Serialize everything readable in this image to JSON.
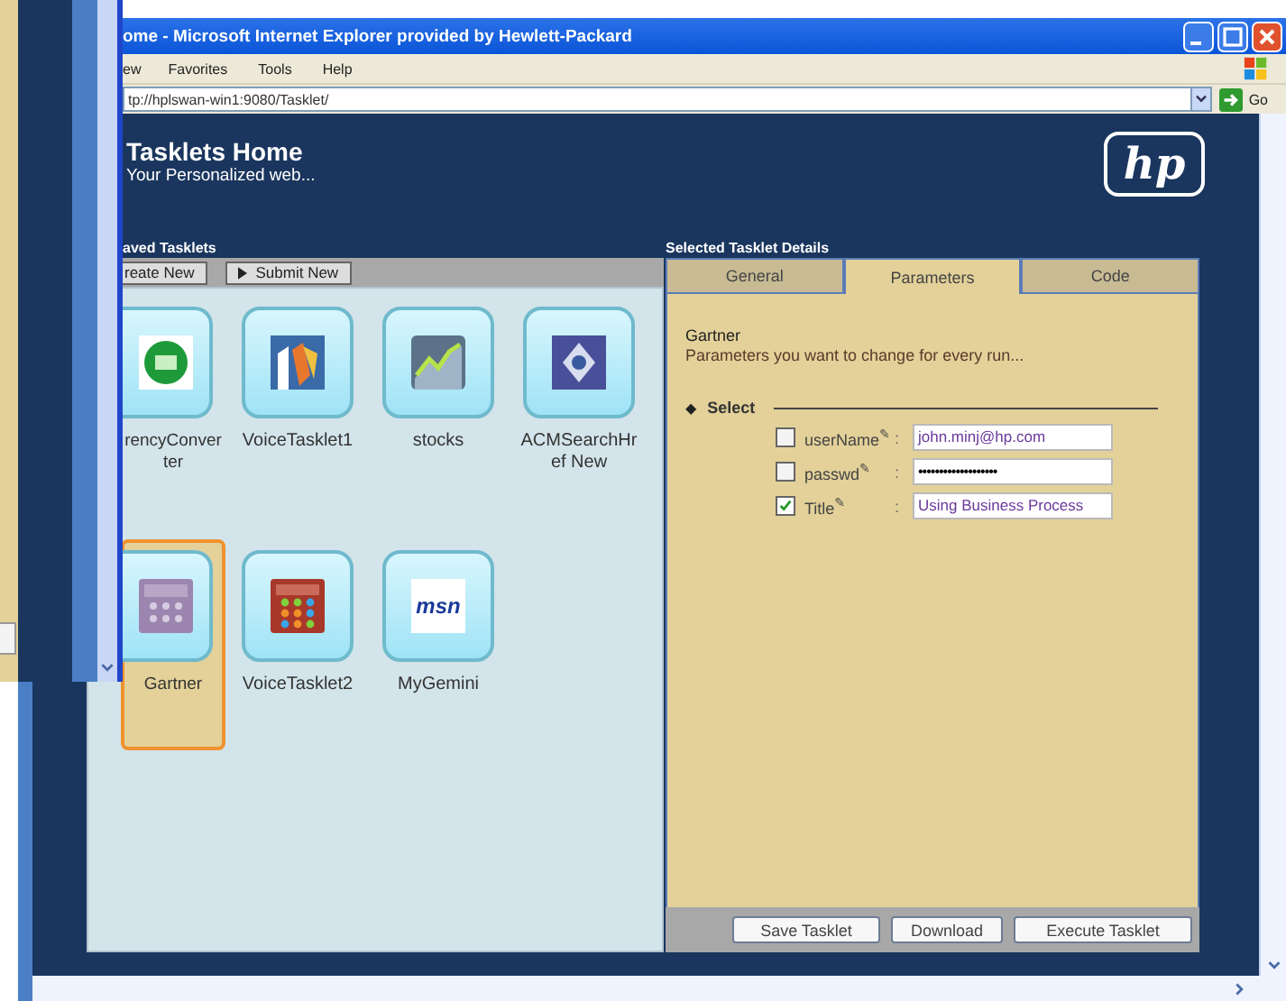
{
  "window": {
    "title": "ome - Microsoft Internet Explorer provided by Hewlett-Packard",
    "menu": [
      "ew",
      "Favorites",
      "Tools",
      "Help"
    ],
    "address": "tp://hplswan-win1:9080/Tasklet/",
    "go_label": "Go"
  },
  "header": {
    "title": "Tasklets Home",
    "subtitle": "Your Personalized web...",
    "logo": "hp"
  },
  "saved_tasklets": {
    "heading": "aved Tasklets",
    "buttons": [
      {
        "label": "reate New",
        "kind": "plain"
      },
      {
        "label": "Submit New",
        "kind": "play"
      }
    ],
    "tasklets": [
      {
        "label": "rencyConverter",
        "kind": "money",
        "selected": false
      },
      {
        "label": "VoiceTasklet1",
        "kind": "map",
        "selected": false
      },
      {
        "label": "stocks",
        "kind": "chart",
        "selected": false
      },
      {
        "label": "ACMSearchHref New",
        "kind": "badge",
        "selected": false
      },
      {
        "label": "Gartner",
        "kind": "calculator",
        "selected": true
      },
      {
        "label": "VoiceTasklet2",
        "kind": "keypad",
        "selected": false
      },
      {
        "label": "MyGemini",
        "kind": "logo",
        "logo_text": "msn",
        "selected": false
      }
    ]
  },
  "details": {
    "heading": "Selected Tasklet Details",
    "tabs": [
      {
        "label": "General",
        "selected": false
      },
      {
        "label": "Parameters",
        "selected": true
      },
      {
        "label": "Code",
        "selected": false
      }
    ],
    "name": "Gartner",
    "description": "Parameters you want to change for every run...",
    "group_marker": "◆",
    "group_label": "Select",
    "fields": [
      {
        "label": "userName$^{✎}$",
        "colon": ":",
        "checked": false,
        "kind": "text",
        "value": "john.minj@hp.com"
      },
      {
        "label": "passwd$^{✎}$",
        "colon": ":",
        "checked": false,
        "kind": "password",
        "value": "•••••••••••••••••••"
      },
      {
        "label": "Title$^{✎}$",
        "colon": ":",
        "checked": true,
        "kind": "text",
        "value": "Using Business Process"
      }
    ],
    "buttons": [
      "Save Tasklet",
      "Download",
      "Execute Tasklet"
    ]
  }
}
